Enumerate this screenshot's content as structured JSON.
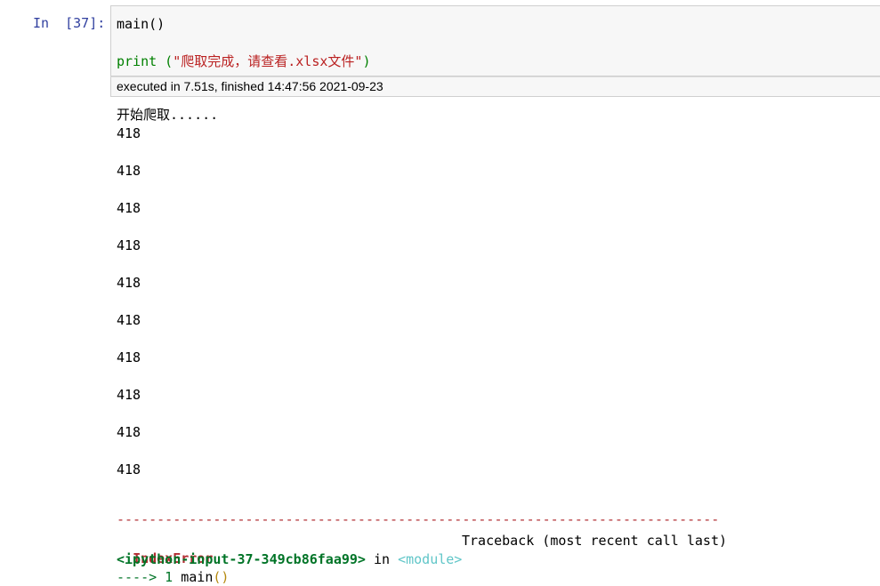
{
  "cell": {
    "prompt": "In  [37]:",
    "code_line1": "main()",
    "code_line2_func": "print",
    "code_line2_open": " (",
    "code_line2_string": "\"爬取完成，请查看.xlsx文件\"",
    "code_line2_close": ")",
    "exec_info": "executed in 7.51s, finished 14:47:56 2021-09-23"
  },
  "output": {
    "start_text": "开始爬取......",
    "lines": [
      "418",
      "418",
      "418",
      "418",
      "418",
      "418",
      "418",
      "418",
      "418",
      "418"
    ]
  },
  "traceback": {
    "separator": "---------------------------------------------------------------------------",
    "error_name": "IndexError",
    "label": "Traceback (most recent call last)",
    "file_ref": "<ipython-input-37-349cb86faa99>",
    "in_word": " in ",
    "module_ref": "<module>",
    "arrow": "----> 1 ",
    "arrow_code": "main",
    "arrow_parens": "()"
  },
  "colors": {
    "prompt": "#303f9f",
    "string": "#ba2121",
    "builtin": "#008000",
    "error": "#b22b31"
  }
}
